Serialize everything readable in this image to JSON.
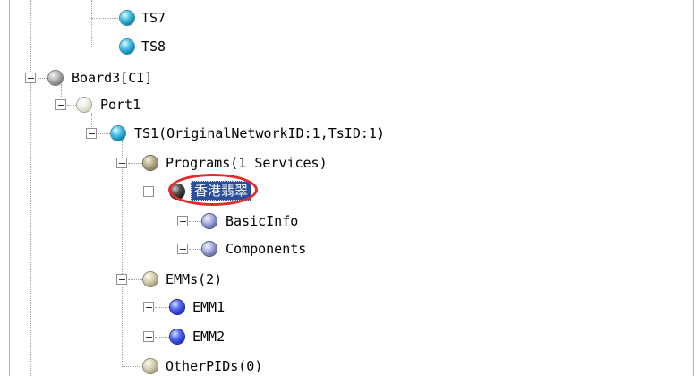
{
  "tree": {
    "ts7": "TS7",
    "ts8": "TS8",
    "board3": "Board3[CI]",
    "port1": "Port1",
    "ts1": "TS1(OriginalNetworkID:1,TsID:1)",
    "programs": "Programs(1 Services)",
    "service": "香港翡翠",
    "basicinfo": "BasicInfo",
    "components": "Components",
    "emms": "EMMs(2)",
    "emm1": "EMM1",
    "emm2": "EMM2",
    "otherpids": "OtherPIDs(0)"
  },
  "colors": {
    "selection": "#2b4f9c",
    "annotation_circle": "#e52a2a",
    "tree_lines": "#a0a0a0"
  },
  "icons": {
    "ts": "teal-ball-icon",
    "board": "gray-ball-icon",
    "port": "white-ball-icon",
    "programs": "olive-ball-icon",
    "service": "black-ball-icon",
    "info": "slate-ball-icon",
    "emm": "blue-ball-icon"
  }
}
